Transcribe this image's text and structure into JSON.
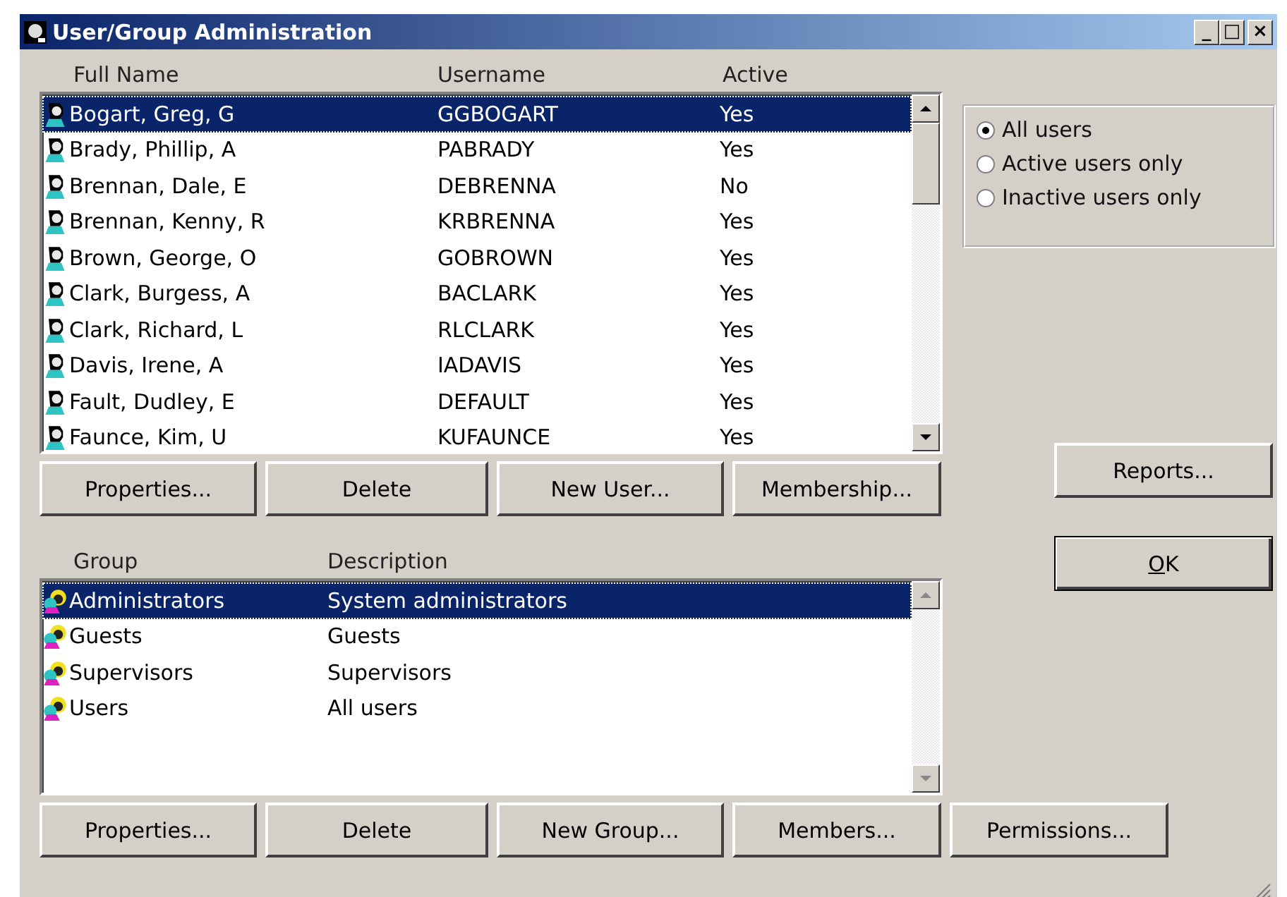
{
  "window": {
    "title": "User/Group Administration",
    "controls": [
      "_",
      "□",
      "×"
    ]
  },
  "users": {
    "columns": [
      "Full Name",
      "Username",
      "Active"
    ],
    "rows": [
      {
        "name": "Bogart, Greg, G",
        "username": "GGBOGART",
        "active": "Yes",
        "selected": true
      },
      {
        "name": "Brady, Phillip, A",
        "username": "PABRADY",
        "active": "Yes",
        "selected": false
      },
      {
        "name": "Brennan, Dale, E",
        "username": "DEBRENNA",
        "active": "No",
        "selected": false
      },
      {
        "name": "Brennan, Kenny, R",
        "username": "KRBRENNA",
        "active": "Yes",
        "selected": false
      },
      {
        "name": "Brown, George, O",
        "username": "GOBROWN",
        "active": "Yes",
        "selected": false
      },
      {
        "name": "Clark, Burgess, A",
        "username": "BACLARK",
        "active": "Yes",
        "selected": false
      },
      {
        "name": "Clark, Richard, L",
        "username": "RLCLARK",
        "active": "Yes",
        "selected": false
      },
      {
        "name": "Davis, Irene, A",
        "username": "IADAVIS",
        "active": "Yes",
        "selected": false
      },
      {
        "name": "Fault, Dudley, E",
        "username": "DEFAULT",
        "active": "Yes",
        "selected": false
      },
      {
        "name": "Faunce, Kim, U",
        "username": "KUFAUNCE",
        "active": "Yes",
        "selected": false
      }
    ],
    "buttons": [
      "Properties...",
      "Delete",
      "New User...",
      "Membership..."
    ]
  },
  "filter": [
    {
      "label": "All users",
      "selected": true
    },
    {
      "label": "Active users only",
      "selected": false
    },
    {
      "label": "Inactive users only",
      "selected": false
    }
  ],
  "side_buttons": [
    "Reports...",
    "OK"
  ],
  "groups": {
    "columns": [
      "Group",
      "Description"
    ],
    "rows": [
      {
        "name": "Administrators",
        "description": "System administrators",
        "selected": true
      },
      {
        "name": "Guests",
        "description": "Guests",
        "selected": false
      },
      {
        "name": "Supervisors",
        "description": "Supervisors",
        "selected": false
      },
      {
        "name": "Users",
        "description": "All users",
        "selected": false
      }
    ],
    "buttons": [
      "Properties...",
      "Delete",
      "New Group...",
      "Members...",
      "Permissions..."
    ]
  }
}
